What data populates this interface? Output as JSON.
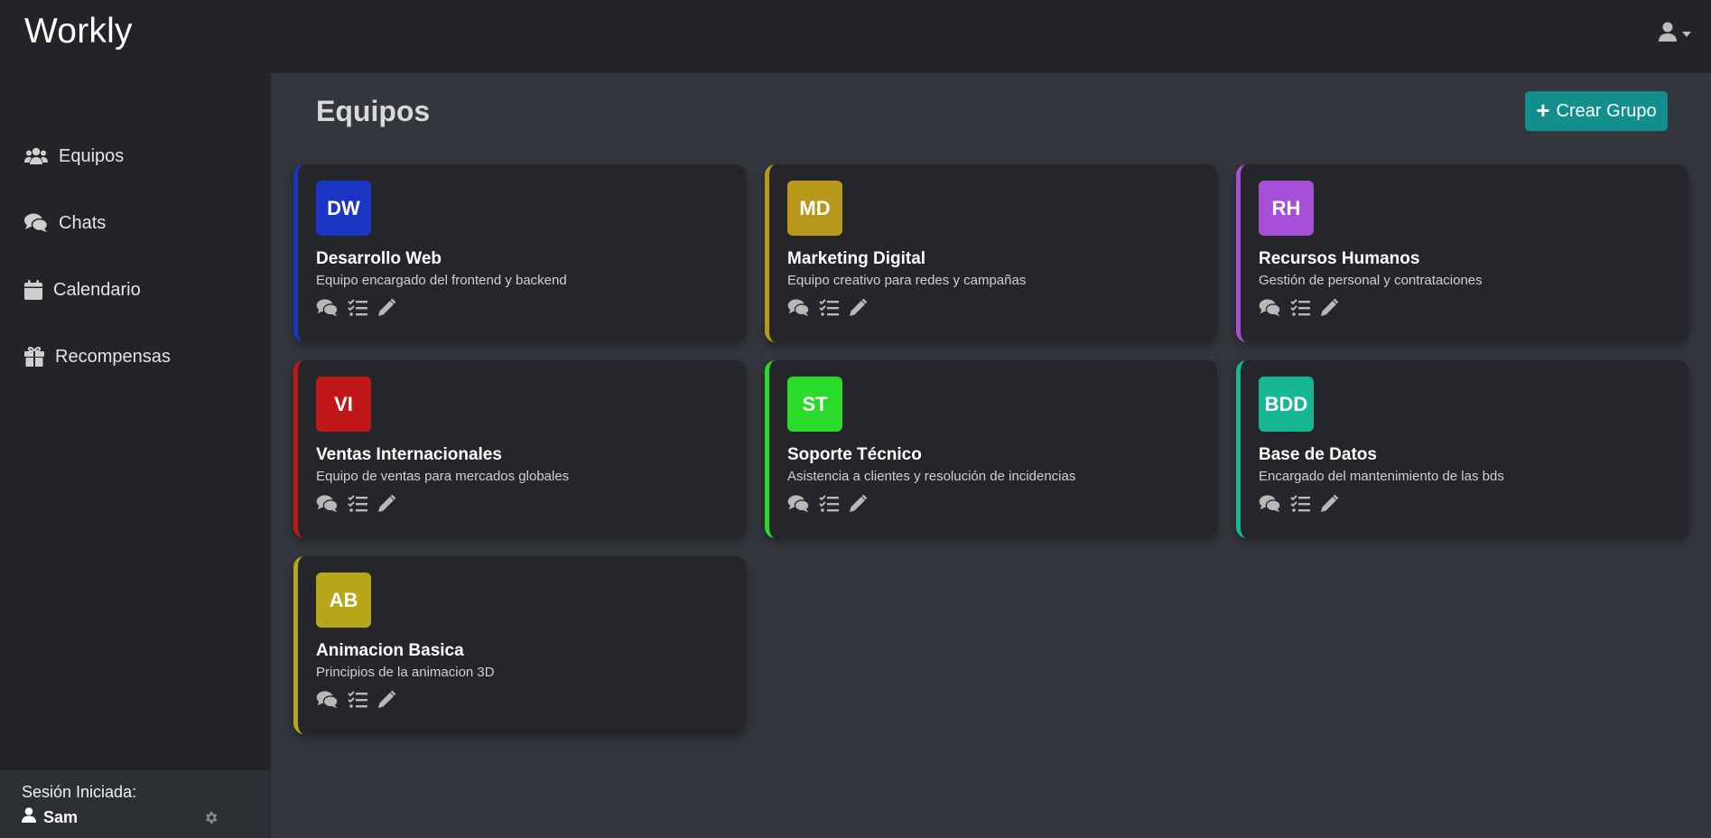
{
  "app": {
    "brand": "Workly"
  },
  "sidebar": {
    "items": [
      {
        "label": "Equipos",
        "icon": "users-icon"
      },
      {
        "label": "Chats",
        "icon": "comments-icon"
      },
      {
        "label": "Calendario",
        "icon": "calendar-icon"
      },
      {
        "label": "Recompensas",
        "icon": "gift-icon"
      }
    ],
    "session": {
      "label": "Sesión Iniciada:",
      "user": "Sam"
    }
  },
  "main": {
    "title": "Equipos",
    "create_button": {
      "plus": "+",
      "label": "Crear Grupo"
    },
    "teams": [
      {
        "initials": "DW",
        "name": "Desarrollo Web",
        "description": "Equipo encargado del frontend y backend",
        "color": "#1a35c4"
      },
      {
        "initials": "MD",
        "name": "Marketing Digital",
        "description": "Equipo creativo para redes y campañas",
        "color": "#b8981a"
      },
      {
        "initials": "RH",
        "name": "Recursos Humanos",
        "description": "Gestión de personal y contrataciones",
        "color": "#a64fd8"
      },
      {
        "initials": "VI",
        "name": "Ventas Internacionales",
        "description": "Equipo de ventas para mercados globales",
        "color": "#c01818"
      },
      {
        "initials": "ST",
        "name": "Soporte Técnico",
        "description": "Asistencia a clientes y resolución de incidencias",
        "color": "#2adb2a"
      },
      {
        "initials": "BDD",
        "name": "Base de Datos",
        "description": "Encargado del mantenimiento de las bds",
        "color": "#16b894"
      },
      {
        "initials": "AB",
        "name": "Animacion Basica",
        "description": "Principios de la animacion 3D",
        "color": "#b8a61a"
      }
    ]
  },
  "colors": {
    "topbar": "#222428",
    "sidebar": "#222428",
    "main_bg": "#33363c",
    "card_bg": "#24262a",
    "accent": "#138e8e"
  }
}
